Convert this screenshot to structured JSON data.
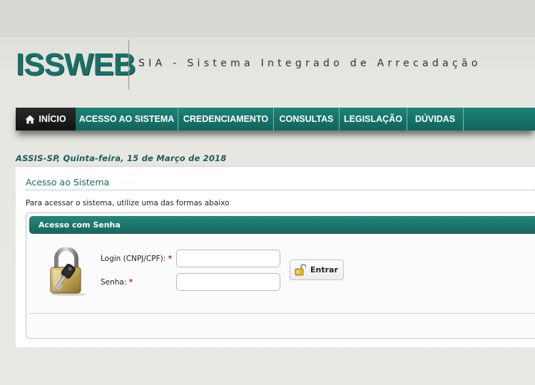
{
  "header": {
    "logo_text": "ISSWEB",
    "system_title": "SIA - Sistema Integrado de Arrecadação"
  },
  "nav": {
    "items": [
      {
        "label": "INÍCIO",
        "icon": "home-icon"
      },
      {
        "label": "ACESSO AO SISTEMA"
      },
      {
        "label": "CREDENCIAMENTO"
      },
      {
        "label": "CONSULTAS"
      },
      {
        "label": "LEGISLAÇÃO"
      },
      {
        "label": "DÚVIDAS"
      }
    ]
  },
  "date_line": "ASSIS-SP, Quinta-feira, 15 de Março de 2018",
  "main": {
    "title": "Acesso ao Sistema",
    "intro": "Para acessar o sistema, utilize uma das formas abaixo",
    "login_box": {
      "header": "Acesso com Senha",
      "login_label": "Login (CNPJ/CPF):",
      "password_label": "Senha:",
      "required_mark": "*",
      "login_value": "",
      "password_value": "",
      "submit_label": "Entrar"
    }
  },
  "colors": {
    "brand_teal": "#1a7068",
    "nav_home_bg": "#111111",
    "required": "#cc1b1b"
  }
}
